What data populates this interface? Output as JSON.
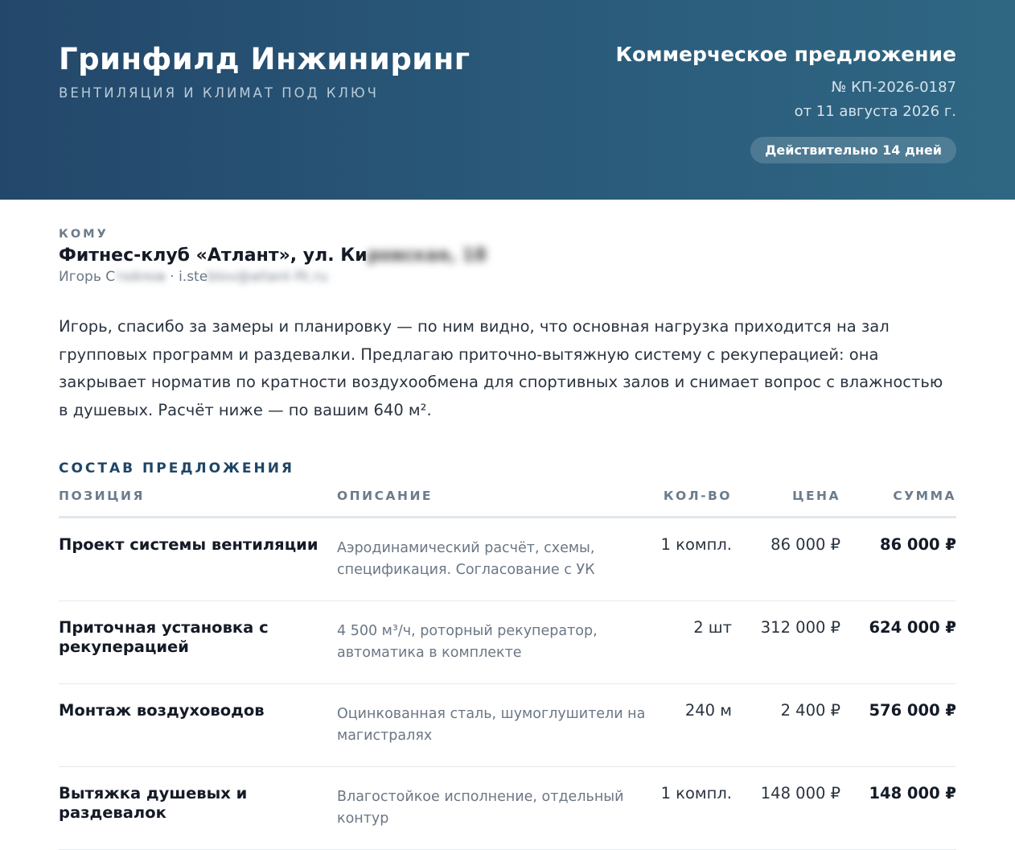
{
  "header": {
    "company_name": "Гринфилд Инжиниринг",
    "company_tagline": "ВЕНТИЛЯЦИЯ И КЛИМАТ ПОД КЛЮЧ",
    "doc_title": "Коммерческое предложение",
    "doc_number": "№ КП-2026-0187",
    "doc_date": "от 11 августа 2026 г.",
    "validity_badge": "Действительно 14 дней"
  },
  "recipient": {
    "label": "КОМУ",
    "name_visible": "Фитнес-клуб «Атлант», ул. Ки",
    "name_obscured": "ровская, 18",
    "contact_name_visible": "Игорь С",
    "contact_name_obscured": "тейлов",
    "separator": " · ",
    "email_visible": "i.ste",
    "email_obscured": "blov@atlant-fit.ru"
  },
  "intro_text": "Игорь, спасибо за замеры и планировку — по ним видно, что основная нагрузка приходится на зал групповых программ и раздевалки. Предлагаю приточно-вытяжную систему с рекуперацией: она закрывает норматив по кратности воздухообмена для спортивных залов и снимает вопрос с влажностью в душевых. Расчёт ниже — по вашим 640 м².",
  "section": {
    "title": "СОСТАВ ПРЕДЛОЖЕНИЯ"
  },
  "table": {
    "columns": [
      "ПОЗИЦИЯ",
      "ОПИСАНИЕ",
      "КОЛ-ВО",
      "ЦЕНА",
      "СУММА"
    ],
    "rows": [
      {
        "position": "Проект системы вентиляции",
        "description": "Аэродинамический расчёт, схемы, спецификация. Согласование с УК",
        "qty": "1 компл.",
        "price": "86 000 ₽",
        "sum": "86 000 ₽"
      },
      {
        "position": "Приточная установка с рекуперацией",
        "description": "4 500 м³/ч, роторный рекуператор, автоматика в комплекте",
        "qty": "2 шт",
        "price": "312 000 ₽",
        "sum": "624 000 ₽"
      },
      {
        "position": "Монтаж воздуховодов",
        "description": "Оцинкованная сталь, шумоглушители на магистралях",
        "qty": "240 м",
        "price": "2 400 ₽",
        "sum": "576 000 ₽"
      },
      {
        "position": "Вытяжка душевых и раздевалок",
        "description": "Влагостойкое исполнение, отдельный контур",
        "qty": "1 компл.",
        "price": "148 000 ₽",
        "sum": "148 000 ₽"
      }
    ]
  }
}
